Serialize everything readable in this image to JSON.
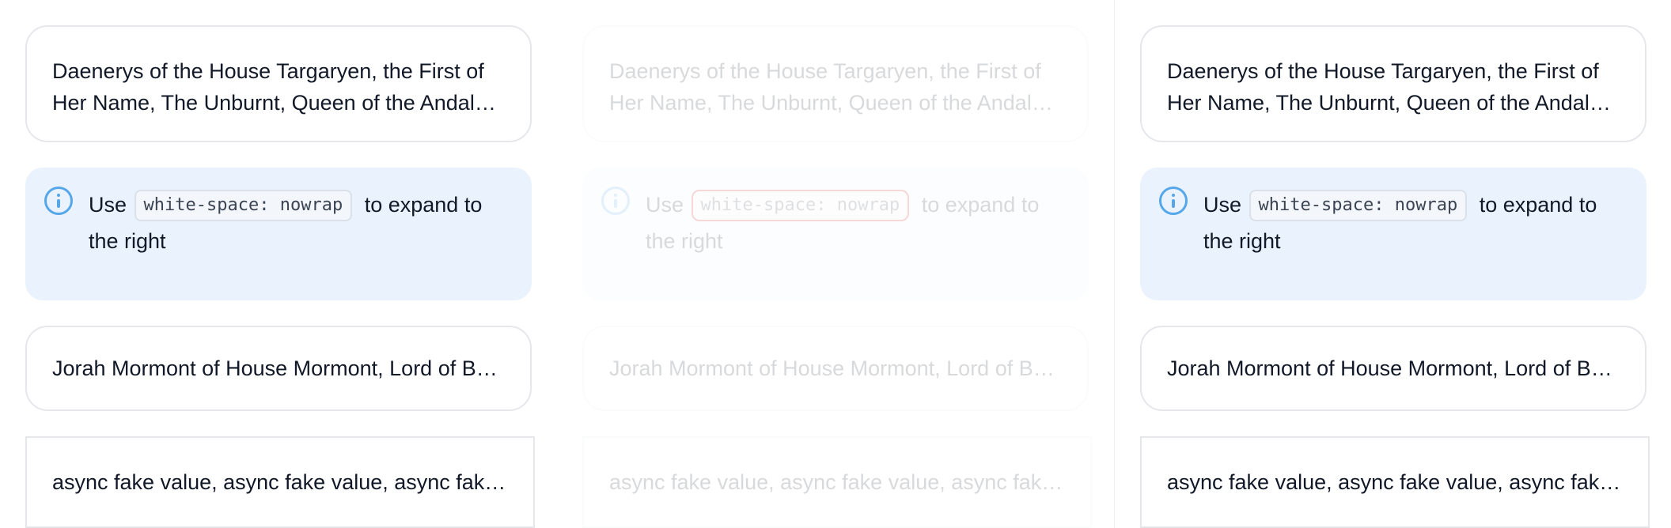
{
  "card_long_title": "Daenerys of the House Targaryen, the First of Her Name, The Unburnt, Queen of the Andals and the First Men",
  "info": {
    "prefix": "Use",
    "code": "white-space: nowrap",
    "suffix": "to expand to the right"
  },
  "card_name": "Jorah Mormont of House Mormont, Lord of Bear Island",
  "card_async": "async fake value, async fake value, async fake value",
  "colors": {
    "info_bg": "#eaf3fd",
    "info_icon": "#56a7ea",
    "highlight_outline": "#d10f0f"
  }
}
